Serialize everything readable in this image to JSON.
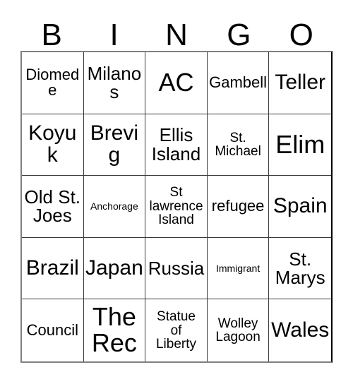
{
  "card": {
    "title": "Bingo Card",
    "header_letters": [
      "B",
      "I",
      "N",
      "G",
      "O"
    ],
    "columns": 5,
    "rows": 5,
    "colors": {
      "text": "#000000",
      "cell_border": "#3a3a3a",
      "outer_border": "#808080",
      "background": "#ffffff"
    },
    "cells": [
      {
        "text": "Diomede",
        "size": "md"
      },
      {
        "text": "Milanos",
        "size": "lg"
      },
      {
        "text": "AC",
        "size": "xxl"
      },
      {
        "text": "Gambell",
        "size": "md"
      },
      {
        "text": "Teller",
        "size": "xl"
      },
      {
        "text": "Koyuk",
        "size": "xl"
      },
      {
        "text": "Brevig",
        "size": "xl"
      },
      {
        "text": "Ellis\nIsland",
        "size": "lg"
      },
      {
        "text": "St.\nMichael",
        "size": "sm"
      },
      {
        "text": "Elim",
        "size": "xxl"
      },
      {
        "text": "Old St.\nJoes",
        "size": "lg"
      },
      {
        "text": "Anchorage",
        "size": "xs"
      },
      {
        "text": "St\nlawrence\nIsland",
        "size": "sm"
      },
      {
        "text": "refugee",
        "size": "md"
      },
      {
        "text": "Spain",
        "size": "xl"
      },
      {
        "text": "Brazil",
        "size": "xl"
      },
      {
        "text": "Japan",
        "size": "xl"
      },
      {
        "text": "Russia",
        "size": "lg"
      },
      {
        "text": "Immigrant",
        "size": "xs"
      },
      {
        "text": "St.\nMarys",
        "size": "lg"
      },
      {
        "text": "Council",
        "size": "md"
      },
      {
        "text": "The\nRec",
        "size": "xxl"
      },
      {
        "text": "Statue\nof\nLiberty",
        "size": "sm"
      },
      {
        "text": "Wolley\nLagoon",
        "size": "sm"
      },
      {
        "text": "Wales",
        "size": "xl"
      }
    ]
  }
}
